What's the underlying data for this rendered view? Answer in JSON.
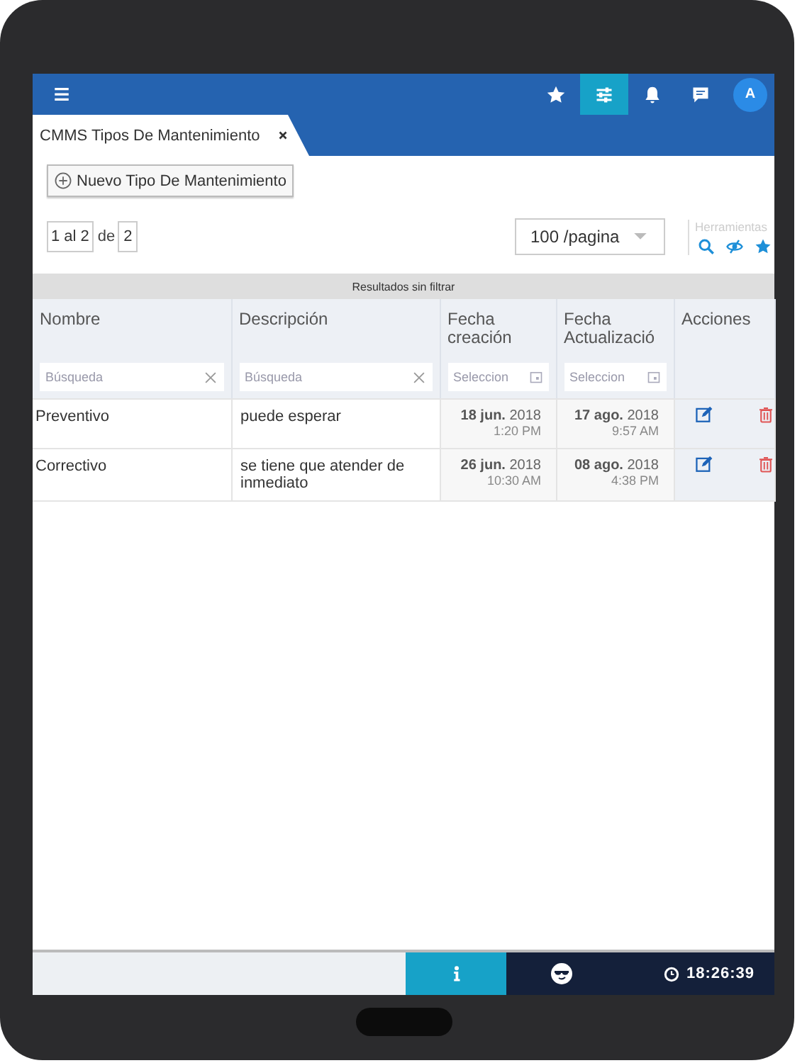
{
  "topbar": {
    "icons": [
      {
        "kind": "star",
        "selected": false
      },
      {
        "kind": "sliders",
        "selected": true
      },
      {
        "kind": "bell",
        "selected": false
      },
      {
        "kind": "chat",
        "selected": false
      }
    ],
    "avatar": "A"
  },
  "tab": {
    "title": "CMMS Tipos De Mantenimiento"
  },
  "new_button": "Nuevo Tipo De Mantenimiento",
  "pagination": {
    "range": "1 al 2",
    "of": "de",
    "total": "2"
  },
  "page_size": "100 /pagina",
  "tools": {
    "label": "Herramientas"
  },
  "filter_banner": "Resultados sin filtrar",
  "table": {
    "columns": [
      {
        "label": "Nombre",
        "kind": "text",
        "placeholder": "Búsqueda"
      },
      {
        "label": "Descripción",
        "kind": "text",
        "placeholder": "Búsqueda"
      },
      {
        "label": "Fecha creación",
        "kind": "date",
        "placeholder": "Seleccion"
      },
      {
        "label": "Fecha Actualizació",
        "kind": "date",
        "placeholder": "Seleccion"
      },
      {
        "label": "Acciones",
        "kind": "actions"
      }
    ],
    "rows": [
      {
        "name": "Preventivo",
        "description": "puede esperar",
        "created": {
          "date": "**18 jun.** 2018",
          "time": "1:20 PM"
        },
        "updated": {
          "date": "**17 ago.** 2018",
          "time": "9:57 AM"
        }
      },
      {
        "name": "Correctivo",
        "description": "se tiene que atender de inmediato",
        "created": {
          "date": "**26 jun.** 2018",
          "time": "10:30 AM"
        },
        "updated": {
          "date": "**08 ago.** 2018",
          "time": "4:38 PM"
        }
      }
    ]
  },
  "footer": {
    "time": "18:26:39"
  }
}
